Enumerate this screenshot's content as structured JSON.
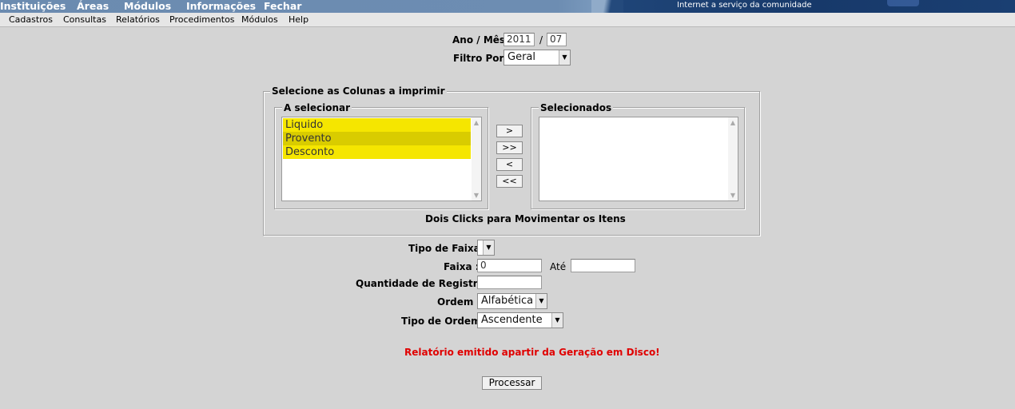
{
  "top_nav": [
    "Instituições",
    "Áreas",
    "Módulos",
    "Informações",
    "Fechar"
  ],
  "tagline": "Internet a serviço da comunidade",
  "menu": [
    "Cadastros",
    "Consultas",
    "Relatórios",
    "Procedimentos",
    "Módulos",
    "Help"
  ],
  "form": {
    "ano_mes_label": "Ano / Mês:",
    "ano_value": "2011",
    "separator": "/",
    "mes_value": "07",
    "filtro_label": "Filtro Por :",
    "filtro_value": "Geral"
  },
  "columns": {
    "legend": "Selecione as Colunas a imprimir",
    "available_legend": "A selecionar",
    "available_items": [
      "Liquido",
      "Provento",
      "Desconto"
    ],
    "selected_legend": "Selecionados",
    "selected_items": [],
    "buttons": {
      "add": ">",
      "add_all": ">>",
      "remove": "<",
      "remove_all": "<<"
    },
    "hint": "Dois Clicks para Movimentar os Itens"
  },
  "filters": {
    "tipo_faixa_label": "Tipo de Faixa :",
    "tipo_faixa_value": "",
    "faixa_label": "Faixa :",
    "faixa_from_value": "0",
    "ate_label": "Até",
    "faixa_to_value": "",
    "quantidade_label": "Quantidade de Registros :",
    "quantidade_value": "",
    "ordem_label": "Ordem :",
    "ordem_value": "Alfabética",
    "tipo_ordem_label": "Tipo de Ordem :",
    "tipo_ordem_value": "Ascendente"
  },
  "message": "Relatório emitido apartir da Geração em Disco!",
  "submit_label": "Processar",
  "colors": {
    "background": "#d4d4d4",
    "highlight_item": "#f5e600",
    "highlight_item_selected": "#d9cc00",
    "message": "#e00000",
    "header_dark": "#1c3f6e"
  }
}
